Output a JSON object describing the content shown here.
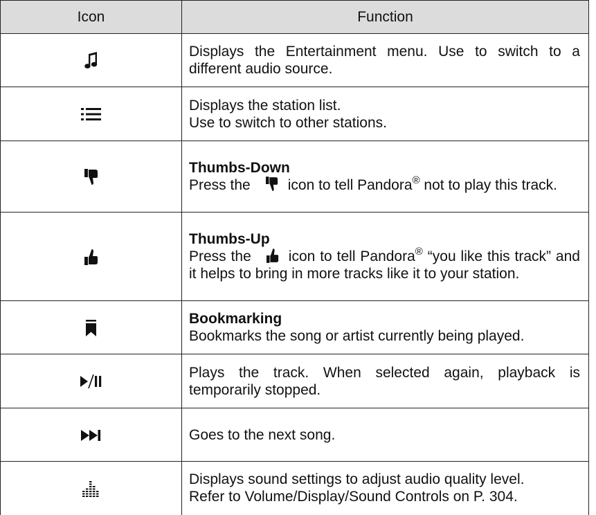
{
  "header": {
    "icon_col": "Icon",
    "function_col": "Function"
  },
  "rows": [
    {
      "icon": "music-note-icon",
      "text": "Displays the Entertainment menu. Use to switch to a different audio source."
    },
    {
      "icon": "list-icon",
      "line1": "Displays the station list.",
      "line2": "Use to switch to other stations."
    },
    {
      "icon": "thumbs-down-icon",
      "heading": "Thumbs-Down",
      "text_before": "Press the",
      "text_after_icon": "icon to tell Pandora",
      "registered": "®",
      "text_end": " not to play this track."
    },
    {
      "icon": "thumbs-up-icon",
      "heading": "Thumbs-Up",
      "text_before": "Press the",
      "text_after_icon": "icon to tell Pandora",
      "registered": "®",
      "text_end": " “you like this track” and it helps to bring in more tracks like it to your station."
    },
    {
      "icon": "bookmark-icon",
      "heading": "Bookmarking",
      "text": "Bookmarks the song or artist currently being played."
    },
    {
      "icon": "play-pause-icon",
      "text": "Plays the track. When selected again, playback is temporarily stopped."
    },
    {
      "icon": "skip-next-icon",
      "text": "Goes to the next song."
    },
    {
      "icon": "equalizer-icon",
      "line1": "Displays sound settings to adjust audio quality level.",
      "line2": "Refer to Volume/Display/Sound Controls on P. 304."
    }
  ]
}
